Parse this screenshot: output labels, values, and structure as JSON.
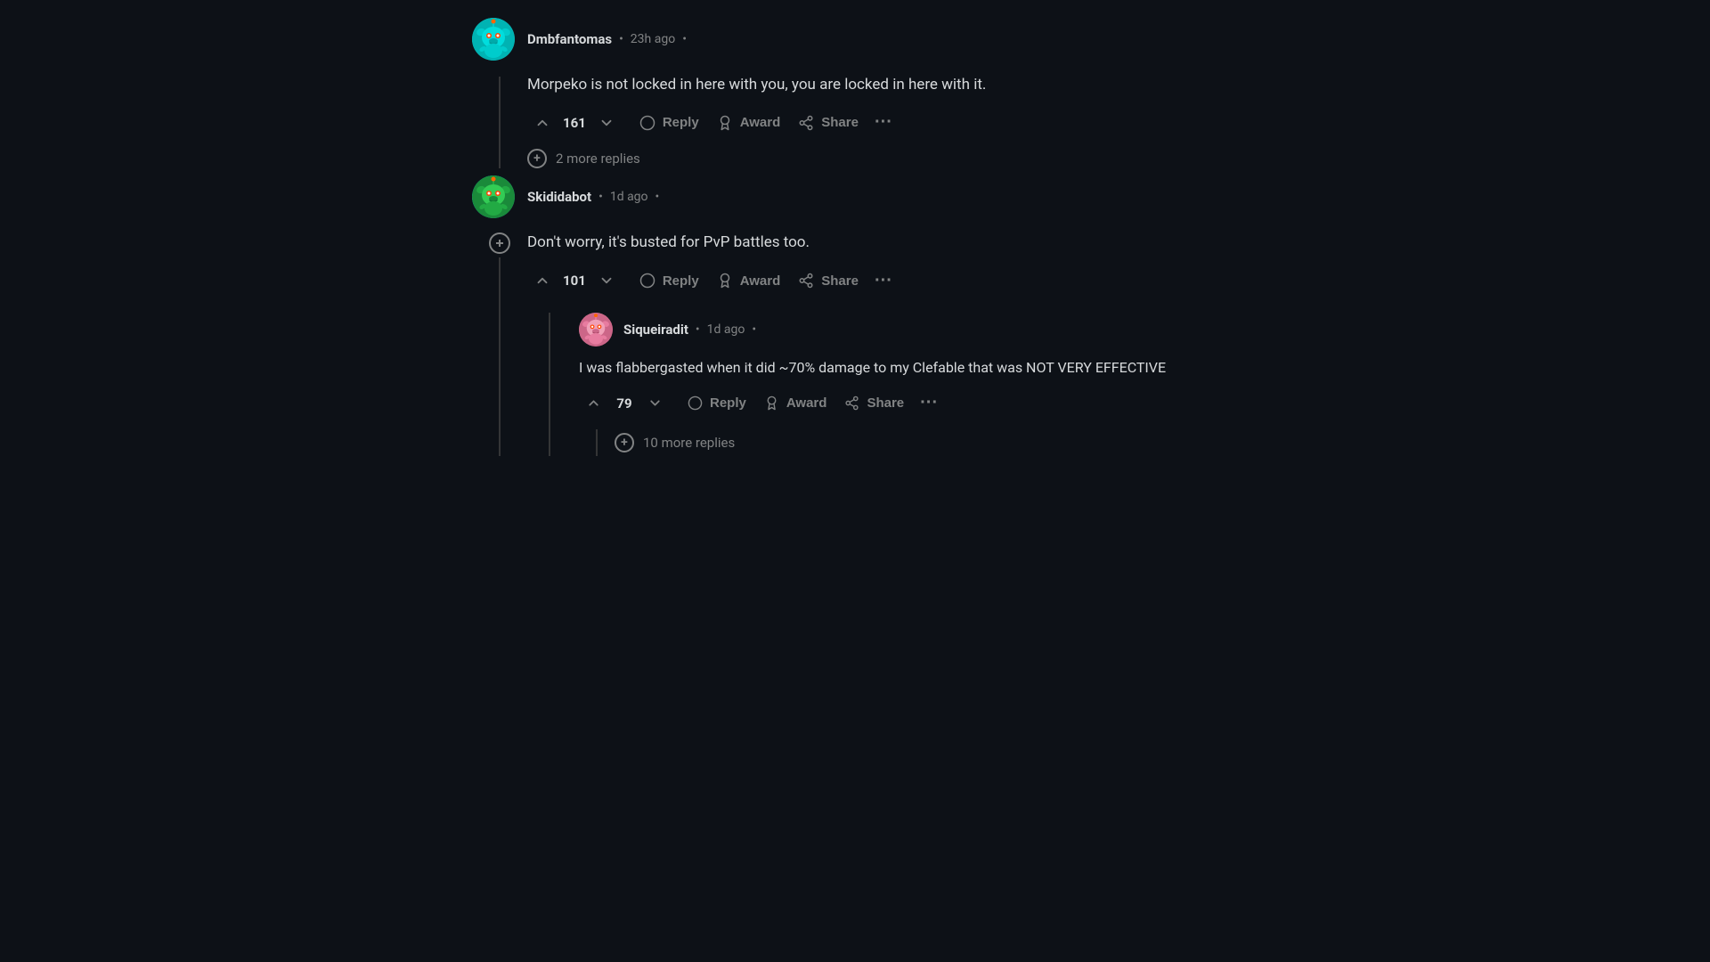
{
  "comments": [
    {
      "id": "comment1",
      "username": "Dmbfantomas",
      "timestamp": "23h ago",
      "avatar_type": "teal",
      "text": "Morpeko is not locked in here with you, you are locked in here with it.",
      "upvotes": "161",
      "actions": [
        "Reply",
        "Award",
        "Share"
      ],
      "more_replies_count": 2,
      "more_replies_text": "2 more replies",
      "has_thread_line": false,
      "replies": []
    },
    {
      "id": "comment2",
      "username": "Skididabot",
      "timestamp": "1d ago",
      "avatar_type": "teal",
      "text": "Don't worry, it's busted for PvP battles too.",
      "upvotes": "101",
      "actions": [
        "Reply",
        "Award",
        "Share"
      ],
      "more_replies_count": 0,
      "more_replies_text": "",
      "has_thread_line": true,
      "replies": [
        {
          "id": "reply1",
          "username": "Siqueiradit",
          "timestamp": "1d ago",
          "avatar_type": "pink",
          "text": "I was flabbergasted when it did ~70% damage to my Clefable that was NOT VERY EFFECTIVE",
          "upvotes": "79",
          "actions": [
            "Reply",
            "Award",
            "Share"
          ],
          "more_replies_count": 10,
          "more_replies_text": "10 more replies"
        }
      ]
    }
  ],
  "labels": {
    "reply": "Reply",
    "award": "Award",
    "share": "Share",
    "more_replies_suffix": "more replies"
  }
}
